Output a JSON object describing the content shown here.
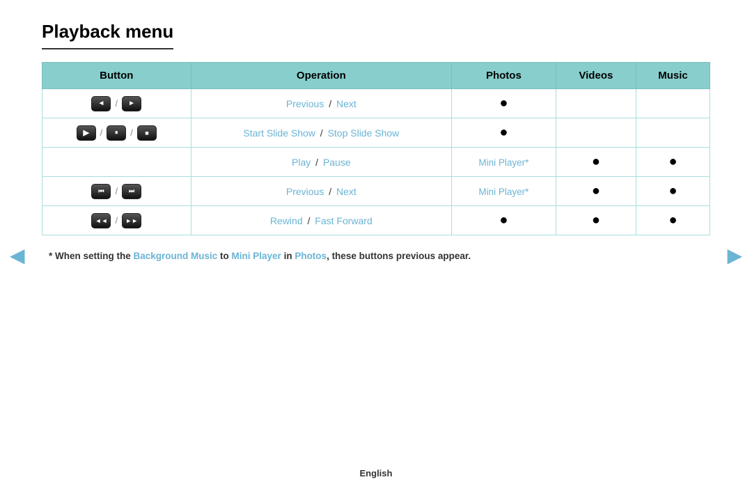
{
  "title": "Playback menu",
  "table": {
    "headers": [
      "Button",
      "Operation",
      "Photos",
      "Videos",
      "Music"
    ],
    "rows": [
      {
        "buttons": [
          {
            "icon": "◄",
            "label": "prev-btn"
          },
          {
            "icon": "►",
            "label": "next-btn"
          }
        ],
        "op_parts": [
          {
            "text": "Previous",
            "type": "link"
          },
          {
            "text": "/",
            "type": "sep"
          },
          {
            "text": "Next",
            "type": "link"
          }
        ],
        "photos": "●",
        "videos": "",
        "music": ""
      },
      {
        "buttons": [
          {
            "icon": "▶",
            "label": "play-btn"
          },
          {
            "icon": "⏸",
            "label": "pause-btn"
          },
          {
            "icon": "■",
            "label": "stop-btn"
          }
        ],
        "op_parts": [
          {
            "text": "Start Slide Show",
            "type": "link"
          },
          {
            "text": "/",
            "type": "sep"
          },
          {
            "text": "Stop Slide Show",
            "type": "link"
          }
        ],
        "photos": "●",
        "videos": "",
        "music": ""
      },
      {
        "buttons": [],
        "op_parts": [
          {
            "text": "Play",
            "type": "link"
          },
          {
            "text": "/",
            "type": "sep"
          },
          {
            "text": "Pause",
            "type": "link"
          }
        ],
        "photos": "mini",
        "videos": "●",
        "music": "●"
      },
      {
        "buttons": [
          {
            "icon": "⏮",
            "label": "skip-prev-btn"
          },
          {
            "icon": "⏭",
            "label": "skip-next-btn"
          }
        ],
        "op_parts": [
          {
            "text": "Previous",
            "type": "link"
          },
          {
            "text": "/",
            "type": "sep"
          },
          {
            "text": "Next",
            "type": "link"
          }
        ],
        "photos": "mini",
        "videos": "●",
        "music": "●"
      },
      {
        "buttons": [
          {
            "icon": "◄◄",
            "label": "rewind-btn"
          },
          {
            "icon": "►►",
            "label": "ffwd-btn"
          }
        ],
        "op_parts": [
          {
            "text": "Rewind",
            "type": "link"
          },
          {
            "text": "/",
            "type": "sep"
          },
          {
            "text": "Fast Forward",
            "type": "link"
          }
        ],
        "photos": "●",
        "videos": "●",
        "music": "●"
      }
    ]
  },
  "footnote": {
    "prefix": "* When setting the ",
    "bg_music": "Background Music",
    "to": " to ",
    "mini_player": "Mini Player",
    "in": " in ",
    "photos": "Photos",
    "suffix": ", these buttons previous appear."
  },
  "nav": {
    "left_arrow": "◄",
    "right_arrow": "►"
  },
  "footer": {
    "language": "English"
  }
}
